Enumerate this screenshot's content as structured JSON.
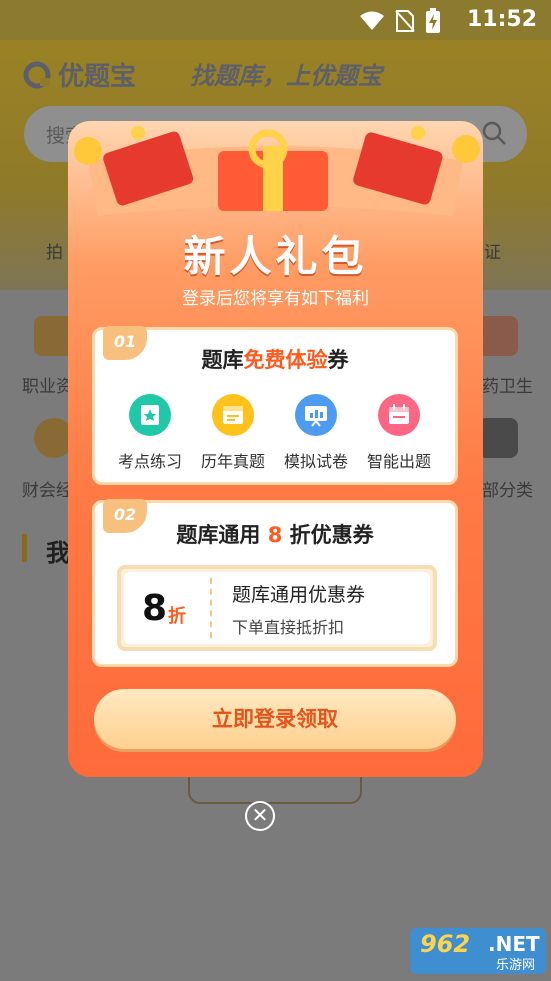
{
  "status_bar": {
    "time": "11:52"
  },
  "background": {
    "app_name": "优题宝",
    "slogan": "找题库，上优题宝",
    "search_placeholder": "搜索",
    "left_labels": [
      "拍",
      "职业资",
      "财会经"
    ],
    "right_labels": [
      "证",
      "药卫生",
      "部分类"
    ],
    "section_title": "我"
  },
  "popup": {
    "title": "新人礼包",
    "subtitle": "登录后您将享有如下福利",
    "card1": {
      "tag": "01",
      "heading_prefix": "题库",
      "heading_highlight": "免费体验",
      "heading_suffix": "券",
      "features": [
        {
          "label": "考点练习",
          "icon": "star-doc-icon",
          "color": "#1fc9a7"
        },
        {
          "label": "历年真题",
          "icon": "calendar-doc-icon",
          "color": "#ffc21a"
        },
        {
          "label": "模拟试卷",
          "icon": "chart-board-icon",
          "color": "#4d9cf0"
        },
        {
          "label": "智能出题",
          "icon": "calendar-icon",
          "color": "#ff6683"
        }
      ]
    },
    "card2": {
      "tag": "02",
      "heading_prefix": "题库通用",
      "heading_highlight": "8",
      "heading_suffix": "折优惠券",
      "coupon": {
        "value": "8",
        "unit": "折",
        "name": "题库通用优惠券",
        "desc": "下单直接抵折扣"
      }
    },
    "cta_label": "立即登录领取",
    "close_label": "✕"
  },
  "watermark": {
    "number": "962",
    "net": ".NET",
    "sub": "乐游网"
  },
  "colors": {
    "accent": "#ff5b1e",
    "popup_top": "#ffd6b0",
    "popup_bottom": "#ff6a3b"
  }
}
